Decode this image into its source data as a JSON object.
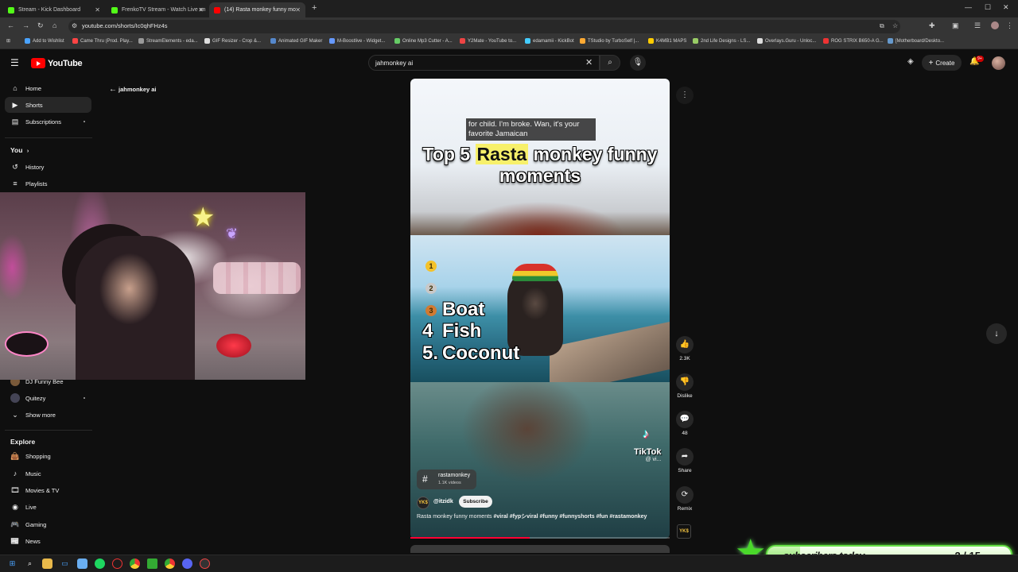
{
  "browser": {
    "tabs": [
      {
        "label": "Stream - Kick Dashboard",
        "color": "#53fc18"
      },
      {
        "label": "FrenkoTV Stream - Watch Live on",
        "color": "#53fc18"
      },
      {
        "label": "(14) Rasta monkey funny mo",
        "color": "#ff0000"
      }
    ],
    "new_tab": "+",
    "url": "youtube.com/shorts/Ic0qhFHz4s",
    "bookmarks": [
      "Add to Wishlist",
      "Came Thru (Prod. Play...",
      "StreamElements - eda...",
      "GIF Resizer - Crop &...",
      "Animated GIF Maker",
      "M-Boostlive - Widget...",
      "Online Mp3 Cutter - A...",
      "Y2Mate - YouTube to...",
      "edamamii - KickBot",
      "TStudio by TurboSelf |...",
      "K4MB1 MAPS",
      "2nd Life Designs - LS...",
      "Overlays.Guru - Unloc...",
      "ROG STRIX B650-A G...",
      "[Motherboard/Deskto..."
    ]
  },
  "youtube": {
    "logo": "YouTube",
    "search_value": "jahmonkey ai",
    "create_label": "Create",
    "notif_count": "9+"
  },
  "sidebar": {
    "items": [
      {
        "label": "Home",
        "icon": "home-icon"
      },
      {
        "label": "Shorts",
        "icon": "shorts-icon"
      },
      {
        "label": "Subscriptions",
        "icon": "subscriptions-icon"
      }
    ],
    "you_header": "You",
    "you_items": [
      {
        "label": "History",
        "icon": "history-icon"
      },
      {
        "label": "Playlists",
        "icon": "playlists-icon"
      }
    ],
    "channels": [
      {
        "label": "DJ Funny Bee"
      },
      {
        "label": "Quitezy"
      }
    ],
    "show_more": "Show more",
    "explore_header": "Explore",
    "explore_items": [
      {
        "label": "Shopping",
        "icon": "shopping-icon"
      },
      {
        "label": "Music",
        "icon": "music-icon"
      },
      {
        "label": "Movies & TV",
        "icon": "movies-icon"
      },
      {
        "label": "Live",
        "icon": "live-icon"
      },
      {
        "label": "Gaming",
        "icon": "gaming-icon"
      },
      {
        "label": "News",
        "icon": "news-icon"
      }
    ]
  },
  "main": {
    "channel_label": "jahmonkey ai"
  },
  "video": {
    "caption": "for child. I'm broke. Wan, it's your favorite Jamaican",
    "title_pre": "Top 5 ",
    "title_hl": "Rasta",
    "title_post": " monkey funny moments",
    "ranks": [
      "1",
      "2",
      "3",
      "Boat",
      "4",
      "Fish",
      "5.",
      "Coconut"
    ],
    "tiktok_label": "TikTok",
    "tiktok_handle": "@ vi...",
    "hashtag_name": "rastamonkey",
    "hashtag_count": "1.1K videos",
    "channel_handle": "@itzidk",
    "subscribe_label": "Subscribe",
    "desc_text": "Rasta monkey funny moments ",
    "desc_tags": "#viral #fypシviral #funny #funnyshorts #fun #rastamonkey",
    "progress": 0.46
  },
  "actions": {
    "likes": "2.3K",
    "dislike": "Dislike",
    "comments": "48",
    "share": "Share",
    "remix": "Remix"
  },
  "overlay": {
    "subs_label": "subscribers today",
    "subs_count": "2 / 15",
    "subs_fraction": 0.1333
  }
}
